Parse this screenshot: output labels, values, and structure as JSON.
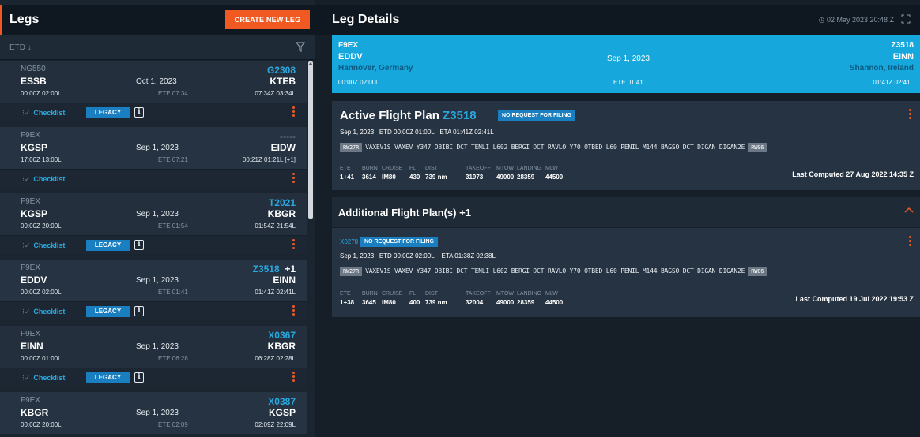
{
  "legs_panel": {
    "title": "Legs",
    "create_button": "CREATE NEW LEG",
    "sort_label": "ETD",
    "legs": [
      {
        "aircraft": "NG550",
        "dep": "ESSB",
        "date": "Oct 1, 2023",
        "dep_times": "00:00Z 02:00L",
        "ete": "ETE 07:34",
        "trip": "G2308",
        "arr": "KTEB",
        "arr_times": "07:34Z 03:34L",
        "checklist": "Checklist",
        "legacy": "LEGACY"
      },
      {
        "aircraft": "F9EX",
        "dep": "KGSP",
        "date": "Sep 1, 2023",
        "dep_times": "17:00Z 13:00L",
        "ete": "ETE 07:21",
        "trip": "-----",
        "arr": "EIDW",
        "arr_times": "00:21Z 01:21L [+1]",
        "checklist": "Checklist"
      },
      {
        "aircraft": "F9EX",
        "dep": "KGSP",
        "date": "Sep 1, 2023",
        "dep_times": "00:00Z 20:00L",
        "ete": "ETE 01:54",
        "trip": "T2021",
        "arr": "KBGR",
        "arr_times": "01:54Z 21:54L",
        "checklist": "Checklist",
        "legacy": "LEGACY"
      },
      {
        "aircraft": "F9EX",
        "dep": "EDDV",
        "date": "Sep 1, 2023",
        "dep_times": "00:00Z 02:00L",
        "ete": "ETE 01:41",
        "trip": "Z3518",
        "trip_extra": "+1",
        "arr": "EINN",
        "arr_times": "01:41Z 02:41L",
        "checklist": "Checklist",
        "legacy": "LEGACY"
      },
      {
        "aircraft": "F9EX",
        "dep": "EINN",
        "date": "Sep 1, 2023",
        "dep_times": "00:00Z 01:00L",
        "ete": "ETE 06:28",
        "trip": "X0367",
        "arr": "KBGR",
        "arr_times": "06:28Z 02:28L",
        "checklist": "Checklist",
        "legacy": "LEGACY"
      },
      {
        "aircraft": "F9EX",
        "dep": "KBGR",
        "date": "Sep 1, 2023",
        "dep_times": "00:00Z 20:00L",
        "ete": "ETE 02:09",
        "trip": "X0387",
        "arr": "KGSP",
        "arr_times": "02:09Z 22:09L"
      }
    ]
  },
  "details": {
    "title": "Leg Details",
    "clock": "02 May 2023 20:48 Z",
    "summary": {
      "aircraft": "F9EX",
      "dep": "EDDV",
      "dep_city": "Hannover, Germany",
      "dep_times": "00:00Z 02:00L",
      "date": "Sep 1, 2023",
      "ete": "ETE 01:41",
      "trip": "Z3518",
      "arr": "EINN",
      "arr_city": "Shannon, Ireland",
      "arr_times": "01:41Z 02:41L"
    },
    "active_plan": {
      "title": "Active Flight Plan",
      "trip": "Z3518",
      "badge": "NO REQUEST FOR FILING",
      "date": "Sep 1, 2023",
      "etd": "ETD 00:00Z 01:00L",
      "eta": "ETA 01:41Z 02:41L",
      "rwy_dep": "RW27R",
      "route": "VAXEV1S VAXEV Y347 OBIBI DCT TENLI L602 BERGI DCT RAVLO Y70 OTBED L60 PENIL M144 BAGSO DCT DIGAN DIGAN2E",
      "rwy_arr": "RW06",
      "labels": [
        "ETE",
        "BURN",
        "CRUISE",
        "FL",
        "DIST",
        "TAKEOFF",
        "MTOW",
        "LANDING",
        "MLW"
      ],
      "values": [
        "1+41",
        "3614",
        "IM80",
        "430",
        "739 nm",
        "31973",
        "49000",
        "28359",
        "44500"
      ],
      "computed": "Last Computed 27 Aug 2022 14:35 Z"
    },
    "additional": {
      "title": "Additional Flight Plan(s) +1",
      "trip": "X0278",
      "badge": "NO REQUEST FOR FILING",
      "date": "Sep 1, 2023",
      "etd": "ETD 00:00Z 02:00L",
      "eta": "ETA 01:38Z 02:38L",
      "rwy_dep": "RW27R",
      "route": "VAXEV1S VAXEV Y347 OBIBI DCT TENLI L602 BERGI DCT RAVLO Y70 OTBED L60 PENIL M144 BAGSO DCT DIGAN DIGAN2E",
      "rwy_arr": "RW06",
      "labels": [
        "ETE",
        "BURN",
        "CRUISE",
        "FL",
        "DIST",
        "TAKEOFF",
        "MTOW",
        "LANDING",
        "MLW"
      ],
      "values": [
        "1+38",
        "3645",
        "IM80",
        "400",
        "739 nm",
        "32004",
        "49000",
        "28359",
        "44500"
      ],
      "computed": "Last Computed 19 Jul 2022 19:53 Z"
    }
  },
  "colors": {
    "accent": "#f05a22",
    "link": "#29a8e0",
    "summary_bg": "#16a7dd",
    "badge": "#1a7fc0"
  }
}
